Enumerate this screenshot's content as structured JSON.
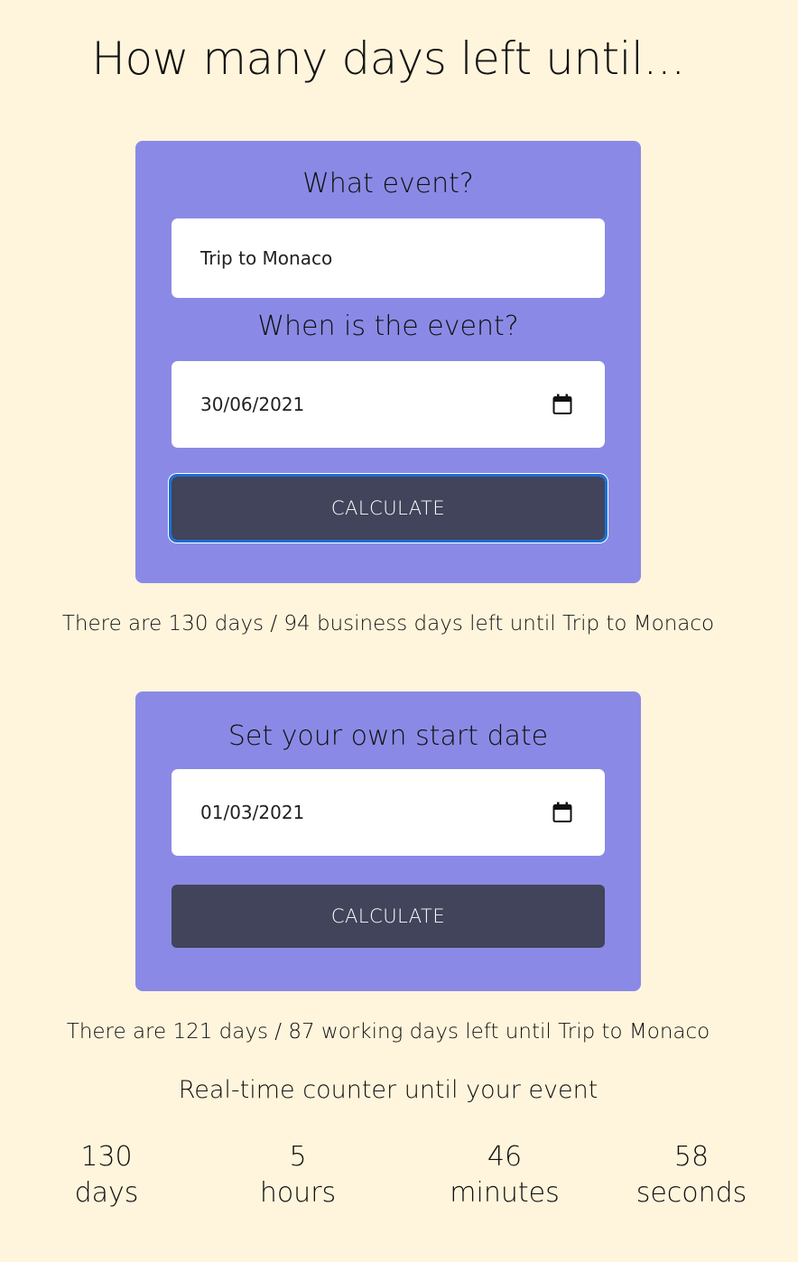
{
  "page": {
    "title": "How many days left until..."
  },
  "event_form": {
    "event_label": "What event?",
    "event_value": "Trip to Monaco",
    "date_label": "When is the event?",
    "date_value": "30/06/2021",
    "calculate_label": "CALCULATE"
  },
  "event_result": "There are 130 days / 94 business days left until Trip to Monaco",
  "start_form": {
    "label": "Set your own start date",
    "date_value": "01/03/2021",
    "calculate_label": "CALCULATE"
  },
  "start_result": "There are 121 days / 87 working days left until Trip to Monaco",
  "counter": {
    "heading": "Real-time counter until your event",
    "units": [
      {
        "value": "130",
        "label": "days"
      },
      {
        "value": "5",
        "label": "hours"
      },
      {
        "value": "46",
        "label": "minutes"
      },
      {
        "value": "58",
        "label": "seconds"
      }
    ]
  },
  "icons": {
    "date_picker": "calendar-icon"
  },
  "colors": {
    "background": "#fff5dc",
    "card": "#8a8ae6",
    "button": "#41445a",
    "focus_ring": "#1a6fd6"
  }
}
